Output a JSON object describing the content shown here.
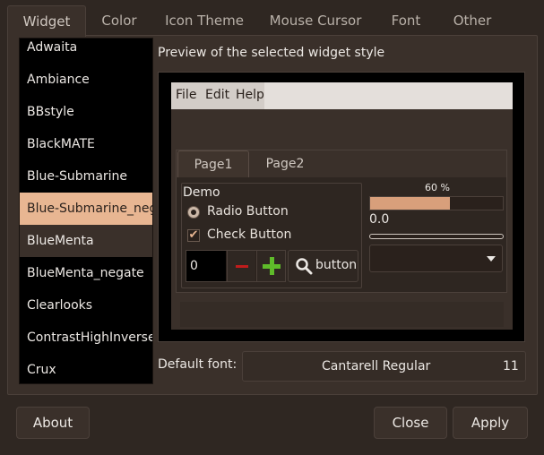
{
  "tabs": [
    "Widget",
    "Color",
    "Icon Theme",
    "Mouse Cursor",
    "Font",
    "Other"
  ],
  "theme_list": {
    "items": [
      "Adwaita",
      "Ambiance",
      "BBstyle",
      "BlackMATE",
      "Blue-Submarine",
      "Blue-Submarine_negate",
      "BlueMenta",
      "BlueMenta_negate",
      "Clearlooks",
      "ContrastHighInverse",
      "Crux"
    ],
    "selected": "Blue-Submarine_negate"
  },
  "preview": {
    "label": "Preview of the selected widget style",
    "menu": [
      "File",
      "Edit",
      "Help"
    ],
    "notebook_tabs": [
      "Page1",
      "Page2"
    ],
    "demo_frame_label": "Demo",
    "radio_label": "Radio Button",
    "check_label": "Check Button",
    "spin_value": "0",
    "search_button_label": "button",
    "progress_text": "60 %",
    "progress_fraction": 0.6,
    "scale_value": "0.0"
  },
  "font_row": {
    "label": "Default font:",
    "font_name": "Cantarell Regular",
    "font_size": "11"
  },
  "buttons": {
    "about": "About",
    "close": "Close",
    "apply": "Apply"
  },
  "colors": {
    "accent": "#e8b692",
    "background": "#2f2722"
  }
}
